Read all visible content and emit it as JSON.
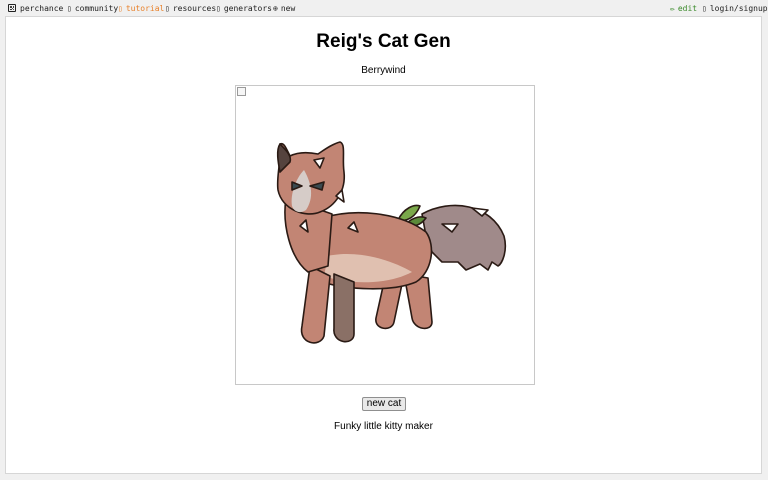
{
  "nav": {
    "logo_label": "perchance",
    "community_label": "community",
    "tutorial_label": "tutorial",
    "resources_label": "resources",
    "generators_label": "generators",
    "new_label": "new",
    "edit_label": "edit",
    "login_label": "login/signup",
    "community_icon": "chat-icon",
    "tutorial_icon": "book-icon",
    "resources_icon": "box-icon",
    "generators_icon": "list-icon",
    "new_icon": "plus-circle-icon",
    "edit_icon": "pencil-icon",
    "login_icon": "user-icon"
  },
  "page": {
    "title": "Reig's Cat Gen",
    "cat_name": "Berrywind",
    "new_cat_button": "new cat",
    "caption": "Funky little kitty maker"
  },
  "colors": {
    "accent_tutorial": "#e8802a",
    "accent_edit": "#3a8a2a",
    "fur_main": "#c28574",
    "fur_dark": "#8a7066",
    "tail": "#a08a8a"
  }
}
